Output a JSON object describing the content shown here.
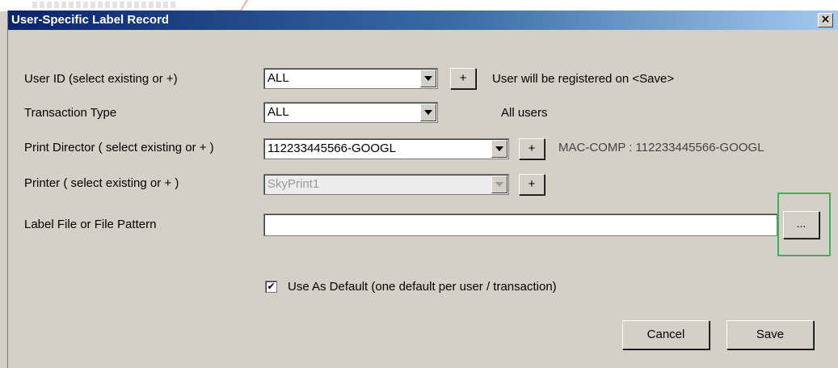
{
  "window": {
    "title": "User-Specific Label Record",
    "close_label": "×"
  },
  "user_id": {
    "label": "User ID (select existing or +)",
    "value": "ALL",
    "add_label": "+",
    "note": "User will be registered on <Save>"
  },
  "transaction_type": {
    "label": "Transaction Type",
    "value": "ALL",
    "note": "All users"
  },
  "print_director": {
    "label": "Print Director ( select existing or + )",
    "value": "112233445566-GOOGL",
    "add_label": "+",
    "note": "MAC-COMP : 112233445566-GOOGL"
  },
  "printer": {
    "label": "Printer ( select existing or + )",
    "value": "SkyPrint1",
    "add_label": "+"
  },
  "label_file": {
    "label": "Label File or File Pattern",
    "value": "",
    "browse_label": "..."
  },
  "use_default": {
    "label": "Use As Default (one default per user / transaction)",
    "check_mark": "✔",
    "checked": true
  },
  "buttons": {
    "cancel": "Cancel",
    "save": "Save"
  },
  "colors": {
    "title_bar_start": "#0a246a",
    "title_bar_end": "#a6caf0",
    "dialog_background": "#d4d0c8",
    "highlight_box": "#3cb35a"
  }
}
